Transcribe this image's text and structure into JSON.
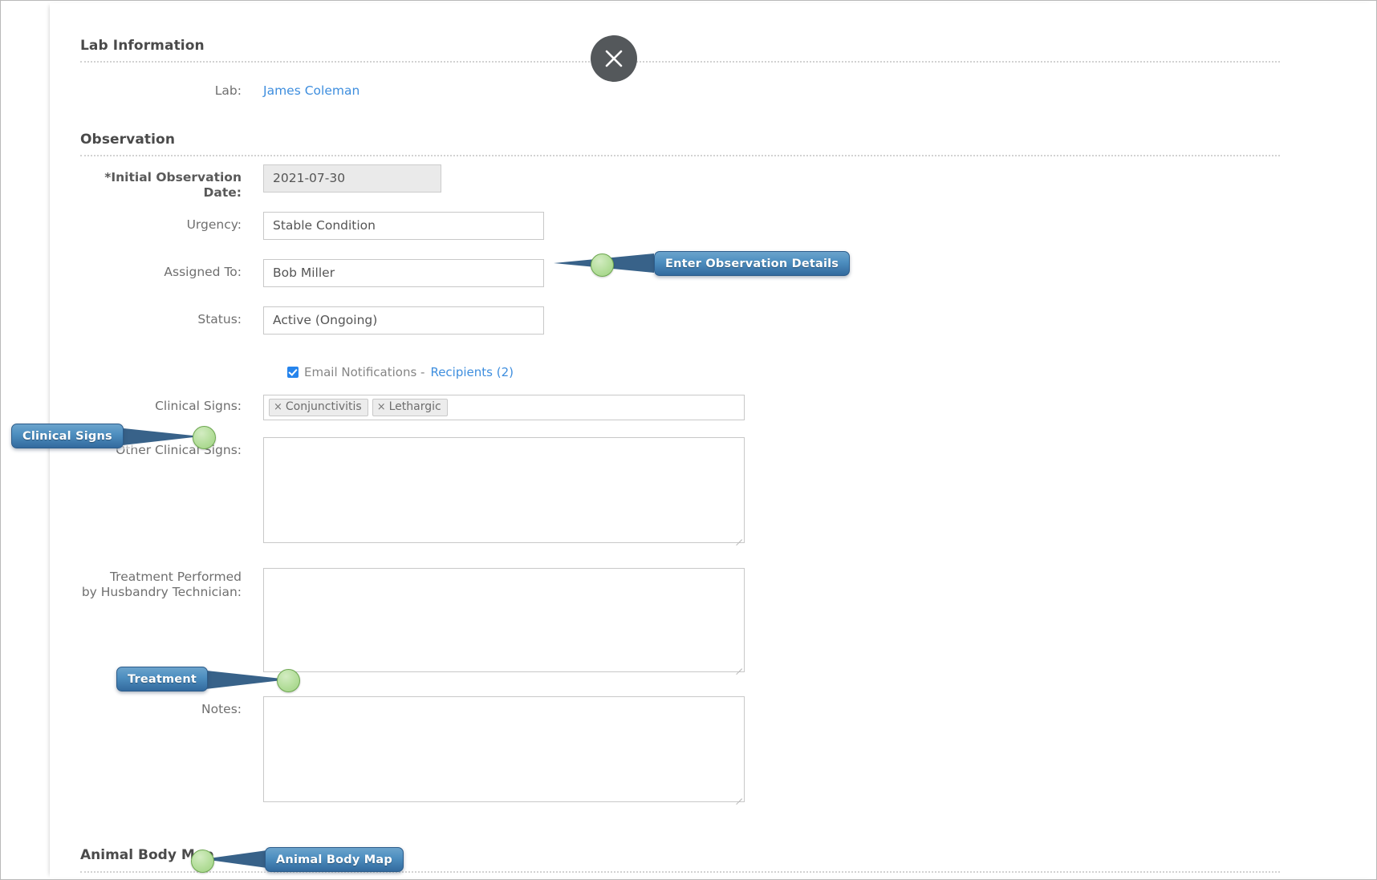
{
  "window": {
    "close_label": "×"
  },
  "sections": {
    "lab": {
      "title": "Lab Information",
      "lab_label": "Lab:",
      "lab_value": "James Coleman"
    },
    "observation": {
      "title": "Observation",
      "fields": {
        "initial_date_label": "*Initial Observation Date:",
        "initial_date_value": "2021-07-30",
        "urgency_label": "Urgency:",
        "urgency_value": "Stable Condition",
        "assigned_label": "Assigned To:",
        "assigned_value": "Bob Miller",
        "status_label": "Status:",
        "status_value": "Active (Ongoing)",
        "email_label": "Email Notifications -",
        "recipients_link": "Recipients (2)",
        "clinical_signs_label": "Clinical Signs:",
        "clinical_signs_tags": [
          "Conjunctivitis",
          "Lethargic"
        ],
        "tag_remove_glyph": "×",
        "other_clinical_signs_label": "Other Clinical Signs:",
        "other_clinical_signs_value": "",
        "treatment_label": "Treatment Performed\nby Husbandry Technician:",
        "treatment_value": "",
        "notes_label": "Notes:",
        "notes_value": ""
      }
    },
    "body_map": {
      "title": "Animal Body Map"
    }
  },
  "annotations": [
    {
      "text": "Enter Observation Details"
    },
    {
      "text": "Clinical Signs"
    },
    {
      "text": "Treatment"
    },
    {
      "text": "Animal Body Map"
    }
  ],
  "colors": {
    "callout_blue": "#4e8fc0",
    "callout_dot_green": "#b4de9b",
    "link_blue": "#3e8ede",
    "checkbox_blue": "#2684ec",
    "close_gray": "#54585b"
  }
}
